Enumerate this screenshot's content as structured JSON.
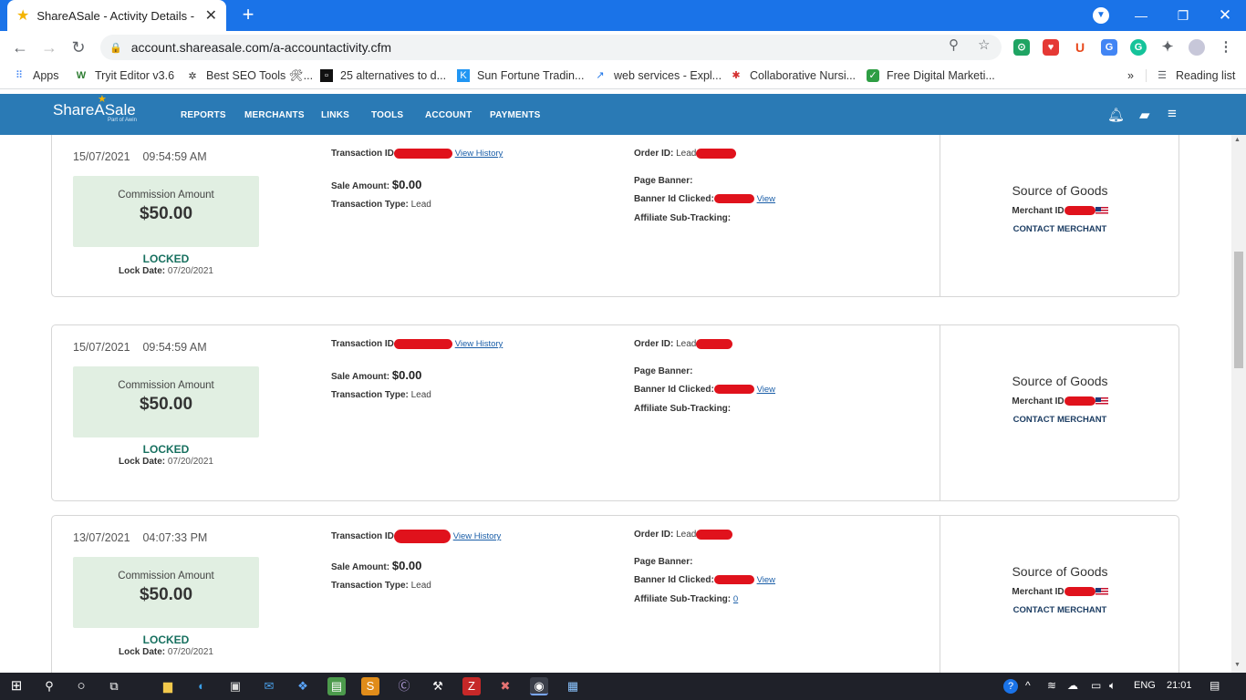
{
  "browser": {
    "tab_title": "ShareASale - Activity Details - Affi",
    "new_tab": "+",
    "close_tab": "✕",
    "url": "account.shareasale.com/a-accountactivity.cfm",
    "reading_list": "Reading list",
    "more_bookmarks": "»"
  },
  "bookmarks": [
    {
      "label": "Apps"
    },
    {
      "label": "Tryit Editor v3.6"
    },
    {
      "label": "Best SEO Tools 🛠..."
    },
    {
      "label": "25 alternatives to d..."
    },
    {
      "label": "Sun Fortune Tradin..."
    },
    {
      "label": "web services - Expl..."
    },
    {
      "label": "Collaborative Nursi..."
    },
    {
      "label": "Free Digital Marketi..."
    }
  ],
  "header": {
    "logo": "ShareASale",
    "logo_sub": "Part of Awin",
    "nav": [
      "REPORTS",
      "MERCHANTS",
      "LINKS",
      "TOOLS",
      "ACCOUNT",
      "PAYMENTS"
    ]
  },
  "labels": {
    "commission": "Commission Amount",
    "locked": "LOCKED",
    "lock_date": "Lock Date:",
    "transaction_id": "Transaction ID",
    "view_history": "View History",
    "sale_amount": "Sale Amount:",
    "transaction_type": "Transaction Type:",
    "order_id": "Order ID:",
    "page_banner": "Page Banner:",
    "banner_id": "Banner Id Clicked:",
    "view": "View",
    "affiliate_sub": "Affiliate Sub-Tracking:",
    "source": "Source of Goods",
    "merchant_id": "Merchant ID",
    "contact": "CONTACT MERCHANT"
  },
  "transactions": [
    {
      "date": "15/07/2021",
      "time": "09:54:59 AM",
      "commission": "$50.00",
      "lock_date": "07/20/2021",
      "sale_amount": "$0.00",
      "type": "Lead",
      "order_prefix": "Lead",
      "sub_tracking": ""
    },
    {
      "date": "15/07/2021",
      "time": "09:54:59 AM",
      "commission": "$50.00",
      "lock_date": "07/20/2021",
      "sale_amount": "$0.00",
      "type": "Lead",
      "order_prefix": "Lead",
      "sub_tracking": ""
    },
    {
      "date": "13/07/2021",
      "time": "04:07:33 PM",
      "commission": "$50.00",
      "lock_date": "07/20/2021",
      "sale_amount": "$0.00",
      "type": "Lead",
      "order_prefix": "Lead",
      "sub_tracking": "0"
    }
  ],
  "taskbar": {
    "lang": "ENG",
    "clock": "21:01"
  },
  "colors": {
    "chrome_blue": "#1a73e8",
    "sas_header": "#2a7ab5",
    "commission_bg": "#e1efe2",
    "locked_green": "#17705f",
    "redaction": "#e0121c"
  }
}
